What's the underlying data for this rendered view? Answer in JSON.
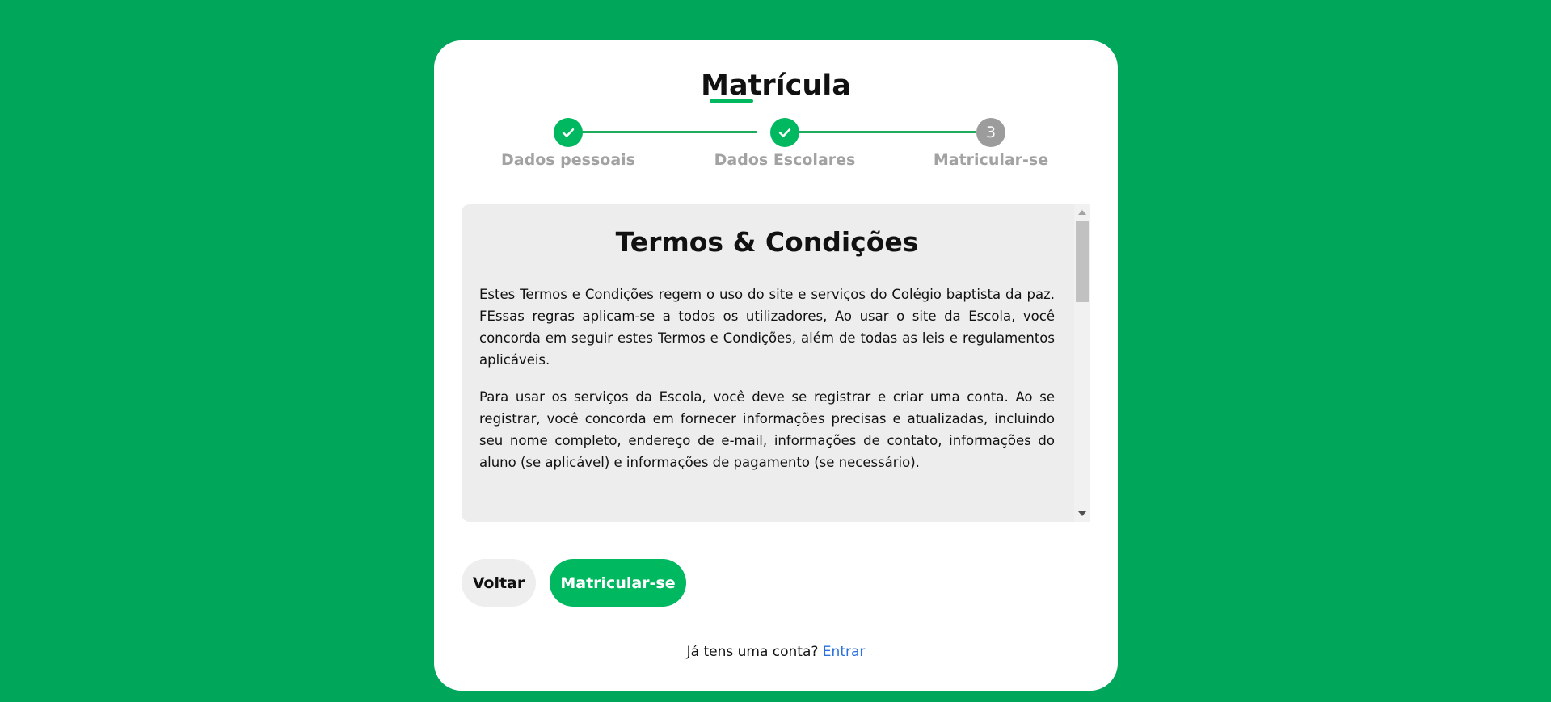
{
  "page": {
    "background_color": "#00a65a",
    "accent_color": "#00b85f",
    "link_color": "#2a6fdb"
  },
  "form": {
    "title": "Matrícula"
  },
  "stepper": {
    "steps": [
      {
        "label": "Dados pessoais",
        "status": "completed",
        "icon": "check-icon"
      },
      {
        "label": "Dados Escolares",
        "status": "completed",
        "icon": "check-icon"
      },
      {
        "label": "Matricular-se",
        "status": "current",
        "number": "3"
      }
    ]
  },
  "terms": {
    "heading": "Termos & Condições",
    "paragraphs": [
      "Estes Termos e Condições regem o uso do site e serviços do Colégio baptista da paz. FEssas regras aplicam-se a todos os utilizadores, Ao usar o site da Escola, você concorda em seguir estes Termos e Condições, além de todas as leis e regulamentos aplicáveis.",
      "Para usar os serviços da Escola, você deve se registrar e criar uma conta. Ao se registrar, você concorda em fornecer informações precisas e atualizadas, incluindo seu nome completo, endereço de e-mail, informações de contato, informações do aluno (se aplicável) e informações de pagamento (se necessário)."
    ]
  },
  "actions": {
    "back_label": "Voltar",
    "enroll_label": "Matricular-se"
  },
  "footer": {
    "question": "Já tens uma conta?",
    "login_link": "Entrar"
  }
}
